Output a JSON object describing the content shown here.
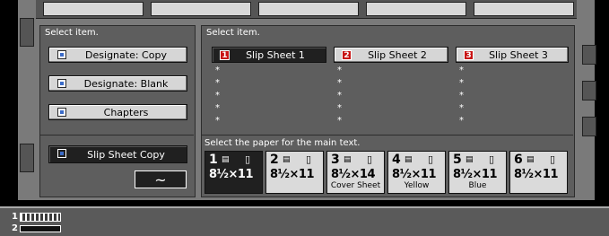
{
  "left_panel": {
    "title": "Select item.",
    "buttons": [
      {
        "label": "Designate: Copy",
        "icon": "copy-page-icon"
      },
      {
        "label": "Designate: Blank",
        "icon": "blank-page-icon"
      },
      {
        "label": "Chapters",
        "icon": "chapters-icon"
      }
    ],
    "slip_sheet_copy": {
      "label": "Slip Sheet Copy",
      "icon": "slip-sheet-copy-icon"
    },
    "tilde_symbol": "~"
  },
  "right_panel": {
    "title": "Select item.",
    "slip_sheets": [
      {
        "number": "1",
        "label": "Slip Sheet 1",
        "selected": true
      },
      {
        "number": "2",
        "label": "Slip Sheet 2",
        "selected": false
      },
      {
        "number": "3",
        "label": "Slip Sheet 3",
        "selected": false
      }
    ],
    "placeholder": "*",
    "paper_prompt": "Select the paper for the main text.",
    "papers": [
      {
        "num": "1",
        "size": "8½×11",
        "caption": "",
        "selected": true
      },
      {
        "num": "2",
        "size": "8½×11",
        "caption": "",
        "selected": false
      },
      {
        "num": "3",
        "size": "8½×14",
        "caption": "Cover Sheet",
        "selected": false
      },
      {
        "num": "4",
        "size": "8½×11",
        "caption": "Yellow",
        "selected": false
      },
      {
        "num": "5",
        "size": "8½×11",
        "caption": "Blue",
        "selected": false
      },
      {
        "num": "6",
        "size": "8½×11",
        "caption": "",
        "selected": false
      }
    ]
  },
  "bottom": {
    "row1": "1",
    "row2": "2"
  }
}
